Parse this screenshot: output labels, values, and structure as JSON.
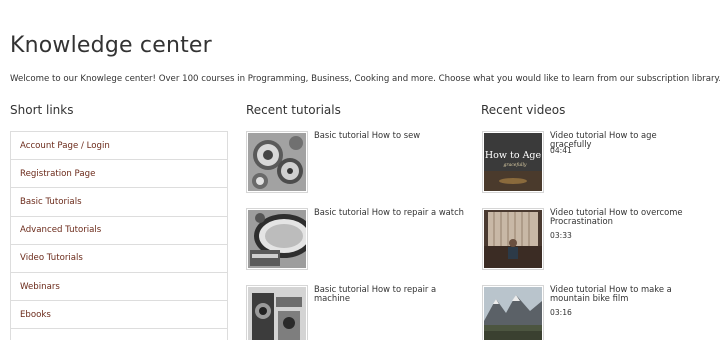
{
  "page": {
    "title": "Knowledge center",
    "intro": "Welcome to our Knowlege center! Over 100 courses in Programming, Business, Cooking and more. Choose what you would like to learn from our subscription library."
  },
  "short_links": {
    "heading": "Short links",
    "items": [
      {
        "label": "Account Page / Login"
      },
      {
        "label": "Registration Page"
      },
      {
        "label": "Basic Tutorials"
      },
      {
        "label": "Advanced Tutorials"
      },
      {
        "label": "Video Tutorials"
      },
      {
        "label": "Webinars"
      },
      {
        "label": "Ebooks"
      }
    ]
  },
  "recent_tutorials": {
    "heading": "Recent tutorials",
    "items": [
      {
        "title": "Basic tutorial How to sew"
      },
      {
        "title": "Basic tutorial How to repair a watch"
      },
      {
        "title": "Basic tutorial How to repair a machine"
      }
    ]
  },
  "recent_videos": {
    "heading": "Recent videos",
    "items": [
      {
        "title": "Video tutorial How to age gracefully",
        "duration": "04:41",
        "thumb_text": "How to Age",
        "thumb_subtext": "gracefully"
      },
      {
        "title": "Video tutorial How to overcome Procrastination",
        "duration": "03:33"
      },
      {
        "title": "Video tutorial How to make a mountain bike film",
        "duration": "03:16"
      }
    ]
  },
  "colors": {
    "link": "#6b2a1a",
    "border": "#dddddd"
  }
}
